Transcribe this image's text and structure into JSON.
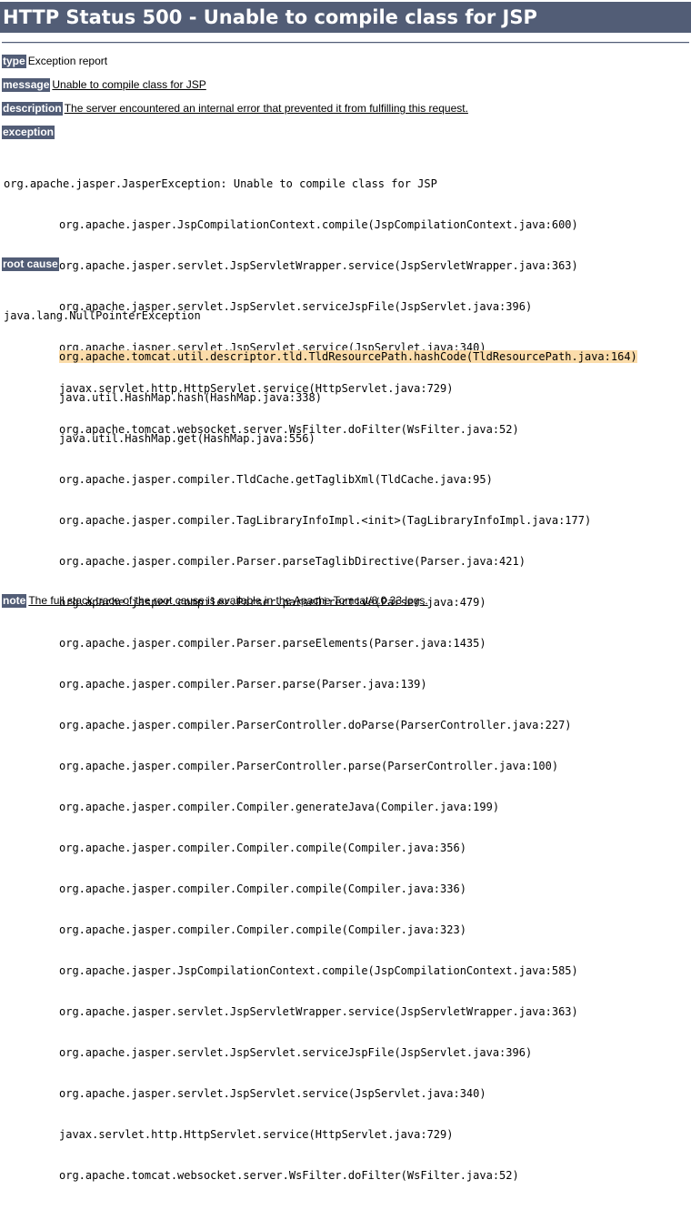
{
  "page": {
    "title": "HTTP Status 500 - Unable to compile class for JSP"
  },
  "fields": {
    "type_label": "type",
    "type_value": "Exception report",
    "message_label": "message",
    "message_value": "Unable to compile class for JSP",
    "description_label": "description",
    "description_value": "The server encountered an internal error that prevented it from fulfilling this request.",
    "exception_label": "exception",
    "root_cause_label": "root cause",
    "note_label": "note",
    "note_value": "The full stack trace of the root cause is available in the Apache Tomcat/8.0.33 logs."
  },
  "exception": {
    "head": "org.apache.jasper.JasperException: Unable to compile class for JSP",
    "frames": [
      "org.apache.jasper.JspCompilationContext.compile(JspCompilationContext.java:600)",
      "org.apache.jasper.servlet.JspServletWrapper.service(JspServletWrapper.java:363)",
      "org.apache.jasper.servlet.JspServlet.serviceJspFile(JspServlet.java:396)",
      "org.apache.jasper.servlet.JspServlet.service(JspServlet.java:340)",
      "javax.servlet.http.HttpServlet.service(HttpServlet.java:729)",
      "org.apache.tomcat.websocket.server.WsFilter.doFilter(WsFilter.java:52)"
    ]
  },
  "root_cause": {
    "head": "java.lang.NullPointerException",
    "highlight_color": "#fbdcaa",
    "frames": [
      "org.apache.tomcat.util.descriptor.tld.TldResourcePath.hashCode(TldResourcePath.java:164)",
      "java.util.HashMap.hash(HashMap.java:338)",
      "java.util.HashMap.get(HashMap.java:556)",
      "org.apache.jasper.compiler.TldCache.getTaglibXml(TldCache.java:95)",
      "org.apache.jasper.compiler.TagLibraryInfoImpl.<init>(TagLibraryInfoImpl.java:177)",
      "org.apache.jasper.compiler.Parser.parseTaglibDirective(Parser.java:421)",
      "org.apache.jasper.compiler.Parser.parseDirective(Parser.java:479)",
      "org.apache.jasper.compiler.Parser.parseElements(Parser.java:1435)",
      "org.apache.jasper.compiler.Parser.parse(Parser.java:139)",
      "org.apache.jasper.compiler.ParserController.doParse(ParserController.java:227)",
      "org.apache.jasper.compiler.ParserController.parse(ParserController.java:100)",
      "org.apache.jasper.compiler.Compiler.generateJava(Compiler.java:199)",
      "org.apache.jasper.compiler.Compiler.compile(Compiler.java:356)",
      "org.apache.jasper.compiler.Compiler.compile(Compiler.java:336)",
      "org.apache.jasper.compiler.Compiler.compile(Compiler.java:323)",
      "org.apache.jasper.JspCompilationContext.compile(JspCompilationContext.java:585)",
      "org.apache.jasper.servlet.JspServletWrapper.service(JspServletWrapper.java:363)",
      "org.apache.jasper.servlet.JspServlet.serviceJspFile(JspServlet.java:396)",
      "org.apache.jasper.servlet.JspServlet.service(JspServlet.java:340)",
      "javax.servlet.http.HttpServlet.service(HttpServlet.java:729)",
      "org.apache.tomcat.websocket.server.WsFilter.doFilter(WsFilter.java:52)"
    ]
  }
}
